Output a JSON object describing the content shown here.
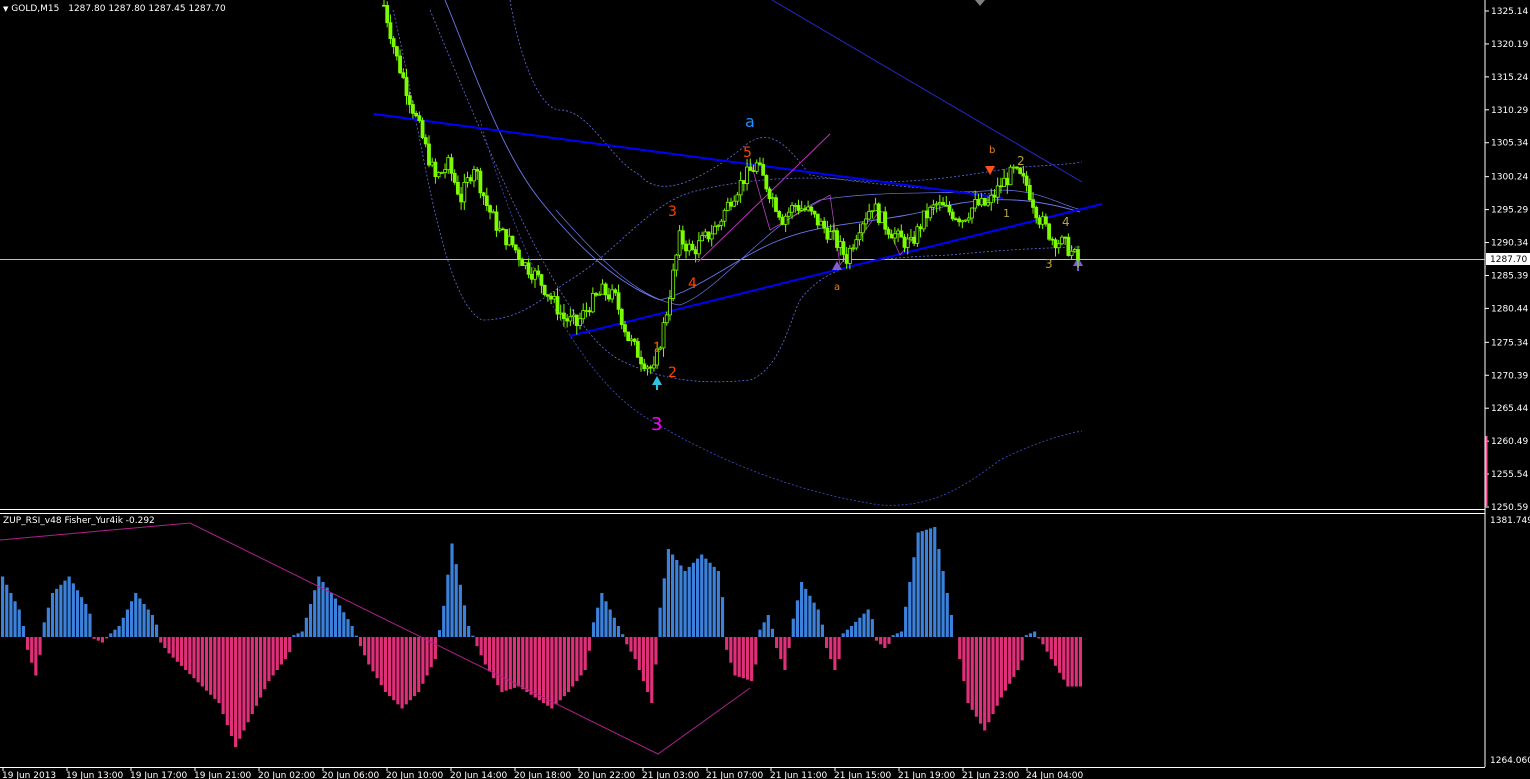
{
  "main_header": {
    "arrow": "▼",
    "symbol": "GOLD,M15",
    "ohlc": "1287.80 1287.80 1287.45 1287.70"
  },
  "indicator_header": "ZUP_RSI_v48  Fisher_Yur4ik -0.292",
  "price_axis": {
    "labels": [
      "1325.14",
      "1320.19",
      "1315.24",
      "1310.29",
      "1305.34",
      "1300.24",
      "1295.29",
      "1290.34",
      "1285.39",
      "1280.44",
      "1275.34",
      "1270.39",
      "1265.44",
      "1260.49",
      "1255.54",
      "1250.59"
    ],
    "current_price": "1287.70"
  },
  "indicator_axis": {
    "top": "1381.749",
    "bottom": "1264.060"
  },
  "time_axis": {
    "labels": [
      "19 Jun 2013",
      "19 Jun 13:00",
      "19 Jun 17:00",
      "19 Jun 21:00",
      "20 Jun 02:00",
      "20 Jun 06:00",
      "20 Jun 10:00",
      "20 Jun 14:00",
      "20 Jun 18:00",
      "20 Jun 22:00",
      "21 Jun 03:00",
      "21 Jun 07:00",
      "21 Jun 11:00",
      "21 Jun 15:00",
      "21 Jun 19:00",
      "21 Jun 23:00",
      "24 Jun 04:00"
    ]
  },
  "wave_labels": {
    "major_a": "a",
    "major_3": "3",
    "w1": "1",
    "w2": "2",
    "w3": "3",
    "w4": "4",
    "w5": "5",
    "minor_a": "a",
    "minor_b": "b",
    "sub_1": "1",
    "sub_2": "2",
    "sub_3": "3",
    "sub_4": "4"
  },
  "colors": {
    "background": "#000000",
    "candle": "#7cfc00",
    "trendline": "#0000ff",
    "channel": "#1e1edc",
    "wave_red": "#ff4500",
    "wave_blue": "#1e90ff",
    "wave_magenta": "#ff00ff",
    "wave_olive": "#b5a642",
    "hist_pos": "#3c82dc",
    "hist_neg": "#e0307a",
    "zigzag": "#b0208c",
    "axis": "#ffffff"
  },
  "chart_data": {
    "type": "candlestick",
    "symbol": "GOLD",
    "timeframe": "M15",
    "ylim": [
      1250.59,
      1325.14
    ],
    "current_price": 1287.7,
    "close_path": [
      [
        0,
        1326
      ],
      [
        2,
        1318
      ],
      [
        4,
        1312
      ],
      [
        6,
        1306
      ],
      [
        8,
        1300
      ],
      [
        10,
        1302
      ],
      [
        12,
        1297
      ],
      [
        14,
        1302
      ],
      [
        16,
        1296
      ],
      [
        18,
        1292
      ],
      [
        20,
        1290
      ],
      [
        22,
        1287
      ],
      [
        24,
        1285
      ],
      [
        26,
        1282
      ],
      [
        28,
        1279
      ],
      [
        30,
        1278
      ],
      [
        32,
        1281
      ],
      [
        34,
        1283
      ],
      [
        36,
        1282
      ],
      [
        38,
        1276
      ],
      [
        40,
        1273
      ],
      [
        42,
        1271
      ],
      [
        44,
        1280
      ],
      [
        46,
        1291
      ],
      [
        48,
        1289
      ],
      [
        50,
        1291
      ],
      [
        52,
        1293
      ],
      [
        54,
        1297
      ],
      [
        56,
        1300
      ],
      [
        58,
        1302
      ],
      [
        60,
        1298
      ],
      [
        62,
        1294
      ],
      [
        64,
        1296
      ],
      [
        66,
        1295
      ],
      [
        68,
        1293
      ],
      [
        70,
        1291
      ],
      [
        72,
        1288
      ],
      [
        74,
        1293
      ],
      [
        76,
        1296
      ],
      [
        78,
        1293
      ],
      [
        80,
        1291
      ],
      [
        82,
        1290
      ],
      [
        84,
        1294
      ],
      [
        86,
        1296
      ],
      [
        88,
        1295
      ],
      [
        90,
        1294
      ],
      [
        92,
        1296
      ],
      [
        94,
        1296
      ],
      [
        96,
        1299
      ],
      [
        98,
        1301
      ],
      [
        100,
        1299
      ],
      [
        102,
        1294
      ],
      [
        104,
        1291
      ],
      [
        106,
        1290
      ],
      [
        108,
        1287.7
      ]
    ],
    "histogram": [
      {
        "name": "Fisher_Yur4ik",
        "values": [
          0.55,
          0.25,
          -0.35,
          0.4,
          0.55,
          0.3,
          -0.05,
          0.1,
          0.4,
          0.2,
          -0.15,
          -0.3,
          -0.45,
          -0.6,
          -1.0,
          -0.7,
          -0.4,
          -0.2,
          0.05,
          0.55,
          0.35,
          0.1,
          -0.25,
          -0.5,
          -0.65,
          -0.5,
          -0.2,
          0.85,
          0.1,
          -0.25,
          -0.5,
          -0.45,
          -0.55,
          -0.65,
          -0.5,
          -0.3,
          0.4,
          0.1,
          -0.2,
          -0.6,
          0.8,
          0.6,
          0.75,
          0.6,
          -0.35,
          -0.4,
          0.2,
          -0.3,
          0.5,
          0.25,
          -0.3,
          0.1,
          0.25,
          -0.1,
          0.05,
          0.95,
          1.0,
          0.2,
          -0.6,
          -0.85,
          -0.55,
          -0.3,
          0.05,
          -0.2,
          -0.45
        ]
      }
    ]
  }
}
